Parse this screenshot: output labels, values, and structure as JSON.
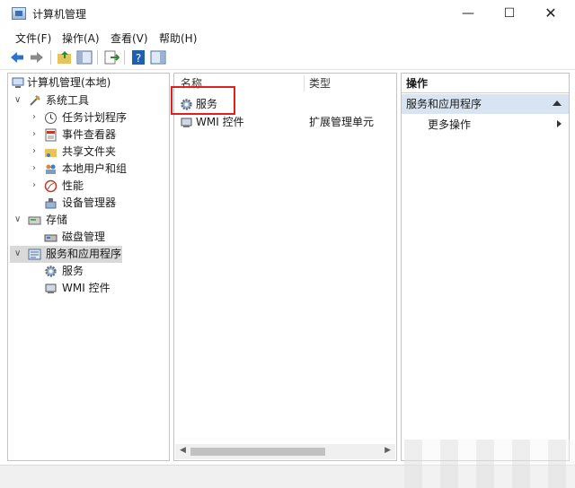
{
  "window": {
    "title": "计算机管理",
    "min_glyph": "—",
    "max_glyph": "☐",
    "close_glyph": "✕"
  },
  "menu": [
    "文件(F)",
    "操作(A)",
    "查看(V)",
    "帮助(H)"
  ],
  "tree": {
    "root": "计算机管理(本地)",
    "system_tools": "系统工具",
    "task_scheduler": "任务计划程序",
    "event_viewer": "事件查看器",
    "shared_folders": "共享文件夹",
    "local_users": "本地用户和组",
    "performance": "性能",
    "device_manager": "设备管理器",
    "storage": "存储",
    "disk_management": "磁盘管理",
    "services_apps": "服务和应用程序",
    "services": "服务",
    "wmi": "WMI 控件"
  },
  "list": {
    "col_name": "名称",
    "col_type": "类型",
    "rows": [
      {
        "name": "服务",
        "type": ""
      },
      {
        "name": "WMI 控件",
        "type": "扩展管理单元"
      }
    ]
  },
  "actions": {
    "header": "操作",
    "section": "服务和应用程序",
    "more": "更多操作"
  },
  "colors": {
    "selection": "#d9d9d9",
    "action_section": "#d9e4f2",
    "highlight": "#e02020"
  }
}
